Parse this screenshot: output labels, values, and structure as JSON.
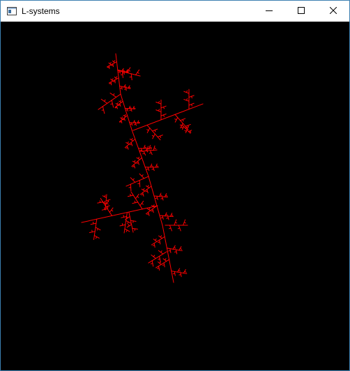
{
  "window": {
    "title": "L-systems",
    "icon": "app-window-icon",
    "controls": [
      "minimize-icon",
      "maximize-icon",
      "close-icon"
    ]
  },
  "canvas": {
    "background": "#000000",
    "stroke_color": "#ff0000",
    "figure": "l-system-fractal"
  }
}
